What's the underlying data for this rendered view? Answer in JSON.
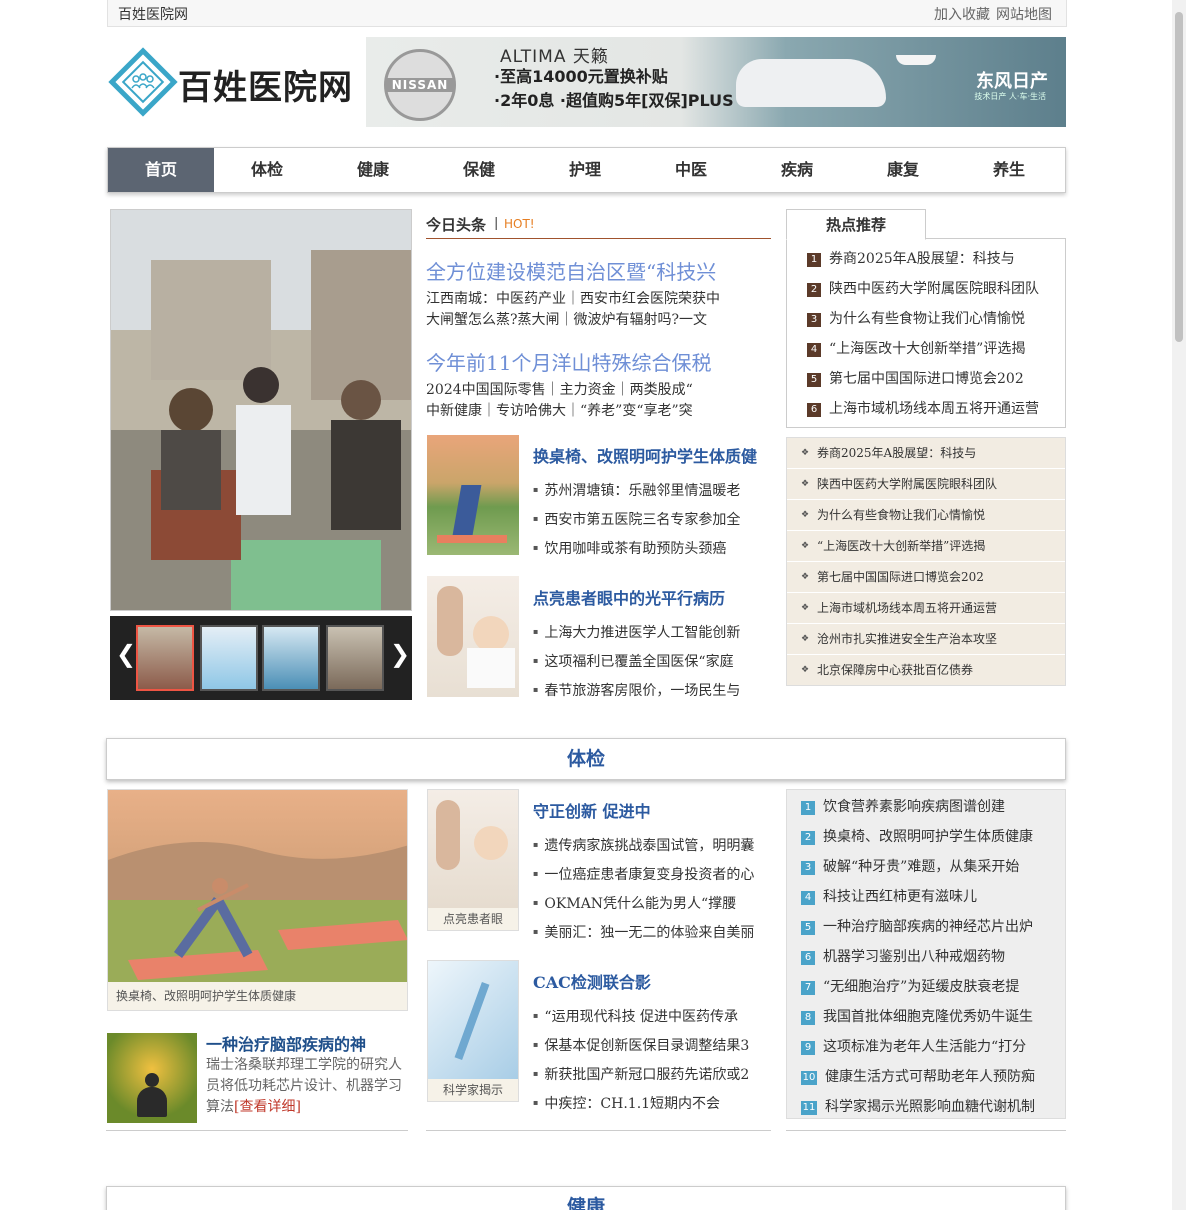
{
  "topbar": {
    "site": "百姓医院网",
    "favorite": "加入收藏",
    "sitemap": "网站地图"
  },
  "logo": {
    "text": "百姓医院网"
  },
  "banner": {
    "maker": "NISSAN",
    "model": "ALTIMA 天籁",
    "line1": "·至高14000元置换补贴",
    "line2": "·2年0息 ·超值购5年[双保]PLUS",
    "brand": "东风日产",
    "slogan": "技术日产 人·车·生活"
  },
  "nav": [
    "首页",
    "体检",
    "健康",
    "保健",
    "护理",
    "中医",
    "疾病",
    "康复",
    "养生"
  ],
  "headlines": {
    "tab": "今日头条",
    "hot": "HOT!",
    "items": [
      {
        "title": "全方位建设模范自治区暨“科技兴",
        "line1": "江西南城：中医药产业｜西安市红会医院荣获中",
        "line2": "大闸蟹怎么蒸?蒸大闸｜微波炉有辐射吗?一文"
      },
      {
        "title": "今年前11个月洋山特殊综合保税",
        "line1": "2024中国国际零售｜主力资金｜两类股成“",
        "line2": "中新健康｜专访哈佛大｜“养老”变“享老”突"
      }
    ]
  },
  "articles": [
    {
      "title": "换桌椅、改照明呵护学生体质健",
      "items": [
        "苏州渭塘镇：乐融邻里情温暖老",
        "西安市第五医院三名专家参加全",
        "饮用咖啡或茶有助预防头颈癌"
      ]
    },
    {
      "title": "点亮患者眼中的光平行病历",
      "items": [
        "上海大力推进医学人工智能创新",
        "这项福利已覆盖全国医保“家庭",
        "春节旅游客房限价，一场民生与"
      ]
    }
  ],
  "hot_recommend": {
    "tab": "热点推荐",
    "items": [
      "券商2025年A股展望：科技与",
      "陕西中医药大学附属医院眼科团队",
      "为什么有些食物让我们心情愉悦",
      "“上海医改十大创新举措”评选揭",
      "第七届中国国际进口博览会202",
      "上海市域机场线本周五将开通运营"
    ]
  },
  "news_list": [
    "券商2025年A股展望：科技与",
    "陕西中医药大学附属医院眼科团队",
    "为什么有些食物让我们心情愉悦",
    "“上海医改十大创新举措”评选揭",
    "第七届中国国际进口博览会202",
    "上海市域机场线本周五将开通运营",
    "沧州市扎实推进安全生产治本攻坚",
    "北京保障房中心获批百亿债券"
  ],
  "section1": {
    "title": "体检",
    "feature_caption": "换桌椅、改照明呵护学生体质健康",
    "small": {
      "title": "一种治疗脑部疾病的神",
      "desc": "瑞士洛桑联邦理工学院的研究人员将低功耗芯片设计、机器学习算法",
      "more": "[查看详细]"
    },
    "mid": [
      {
        "caption": "点亮患者眼",
        "title": "守正创新 促进中",
        "items": [
          "遗传病家族挑战泰国试管，明明囊",
          "一位癌症患者康复变身投资者的心",
          "OKMAN凭什么能为男人“撑腰",
          "美丽汇：独一无二的体验来自美丽"
        ]
      },
      {
        "caption": "科学家揭示",
        "title": "CAC检测联合影",
        "items": [
          "“运用现代科技 促进中医药传承",
          "保基本促创新医保目录调整结果3",
          "新获批国产新冠口服药先诺欣或2",
          "中疾控：CH.1.1短期内不会"
        ]
      }
    ],
    "ranked": [
      "饮食营养素影响疾病图谱创建",
      "换桌椅、改照明呵护学生体质健康",
      "破解“种牙贵”难题，从集采开始",
      "科技让西红柿更有滋味儿",
      "一种治疗脑部疾病的神经芯片出炉",
      "机器学习鉴别出八种戒烟药物",
      "“无细胞治疗”为延缓皮肤衰老提",
      "我国首批体细胞克隆优秀奶牛诞生",
      "这项标准为老年人生活能力“打分",
      "健康生活方式可帮助老年人预防痴",
      "科学家揭示光照影响血糖代谢机制"
    ]
  },
  "section2": {
    "title": "健康"
  },
  "colors": {
    "nav_active": "#5c6572",
    "link_blue": "#2c5aa0",
    "headline_blue": "#6f8fd6",
    "hot_orange": "#e67e22",
    "rank_brown": "#5b3a29",
    "rank_teal": "#4aa3c9"
  }
}
